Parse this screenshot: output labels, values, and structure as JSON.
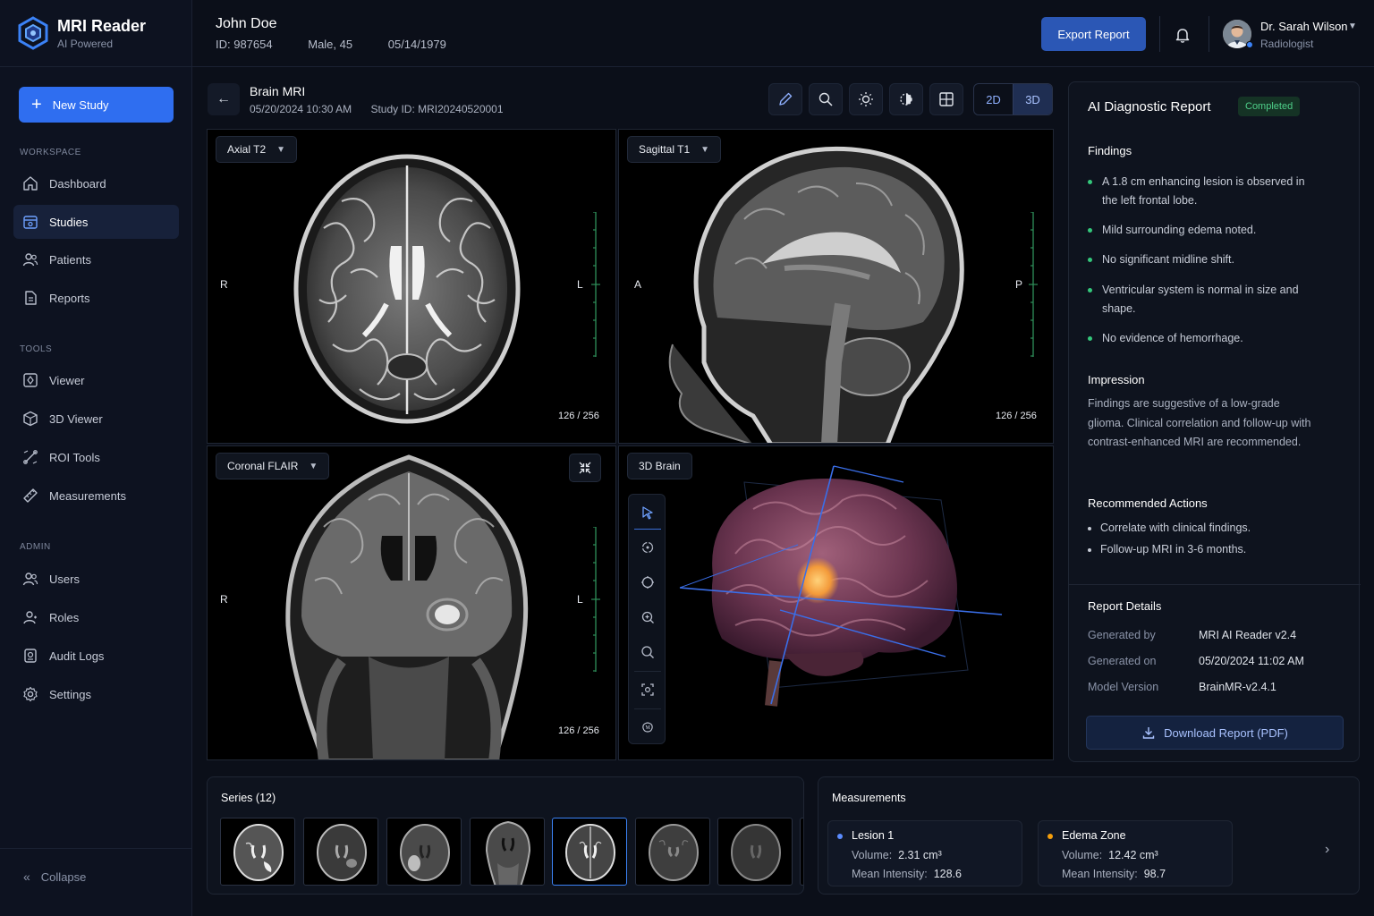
{
  "app": {
    "name": "MRI Reader",
    "tagline": "AI Powered"
  },
  "sidebar": {
    "new_study": "New Study",
    "sections": {
      "workspace": "WORKSPACE",
      "tools": "TOOLS",
      "admin": "ADMIN"
    },
    "workspace": [
      {
        "label": "Dashboard",
        "icon": "home-icon"
      },
      {
        "label": "Studies",
        "icon": "studies-icon",
        "active": true
      },
      {
        "label": "Patients",
        "icon": "patients-icon"
      },
      {
        "label": "Reports",
        "icon": "reports-icon"
      }
    ],
    "tools": [
      {
        "label": "Viewer",
        "icon": "viewer-icon"
      },
      {
        "label": "3D Viewer",
        "icon": "cube-icon"
      },
      {
        "label": "ROI Tools",
        "icon": "roi-icon"
      },
      {
        "label": "Measurements",
        "icon": "ruler-icon"
      }
    ],
    "admin": [
      {
        "label": "Users",
        "icon": "users-icon"
      },
      {
        "label": "Roles",
        "icon": "roles-icon"
      },
      {
        "label": "Audit Logs",
        "icon": "audit-icon"
      },
      {
        "label": "Settings",
        "icon": "gear-icon"
      }
    ],
    "collapse": "Collapse"
  },
  "header": {
    "patient_name": "John Doe",
    "patient_id": "ID: 987654",
    "patient_sex_age": "Male, 45",
    "patient_dob": "05/14/1979",
    "export_label": "Export Report",
    "user_name": "Dr. Sarah Wilson",
    "user_role": "Radiologist"
  },
  "study": {
    "title": "Brain MRI",
    "datetime": "05/20/2024 10:30 AM",
    "study_id": "Study ID: MRI20240520001",
    "view_2d": "2D",
    "view_3d": "3D",
    "tools": [
      "pencil-icon",
      "zoom-icon",
      "brightness-icon",
      "contrast-icon",
      "layout-grid-icon"
    ]
  },
  "viewports": {
    "axial": {
      "label": "Axial T2",
      "left": "R",
      "right": "L",
      "slice": "126 / 256"
    },
    "sagittal": {
      "label": "Sagittal T1",
      "left": "A",
      "right": "P",
      "slice": "126 / 256"
    },
    "coronal": {
      "label": "Coronal FLAIR",
      "left": "R",
      "right": "L",
      "slice": "126 / 256"
    },
    "brain3d": {
      "label": "3D Brain"
    }
  },
  "report": {
    "title": "AI Diagnostic Report",
    "status": "Completed",
    "findings_title": "Findings",
    "findings": [
      "A 1.8 cm enhancing lesion is observed in the left frontal lobe.",
      "Mild surrounding edema noted.",
      "No significant midline shift.",
      "Ventricular system is normal in size and shape.",
      "No evidence of hemorrhage."
    ],
    "impression_title": "Impression",
    "impression": "Findings are suggestive of a low-grade glioma. Clinical correlation and follow-up with contrast-enhanced MRI are recommended.",
    "actions_title": "Recommended Actions",
    "actions": [
      "Correlate with clinical findings.",
      "Follow-up MRI in 3-6 months."
    ],
    "details_title": "Report Details",
    "details": [
      {
        "key": "Generated by",
        "value": "MRI AI Reader v2.4"
      },
      {
        "key": "Generated on",
        "value": "05/20/2024 11:02 AM"
      },
      {
        "key": "Model Version",
        "value": "BrainMR-v2.4.1"
      }
    ],
    "download_label": "Download Report (PDF)"
  },
  "series": {
    "title": "Series (12)",
    "selected_index": 4
  },
  "measurements": {
    "title": "Measurements",
    "items": [
      {
        "name": "Lesion 1",
        "volume_label": "Volume:",
        "volume": "2.31 cm³",
        "intensity_label": "Mean Intensity:",
        "intensity": "128.6",
        "color": "#5b8cff"
      },
      {
        "name": "Edema Zone",
        "volume_label": "Volume:",
        "volume": "12.42 cm³",
        "intensity_label": "Mean Intensity:",
        "intensity": "98.7",
        "color": "#f59e0b"
      }
    ]
  }
}
